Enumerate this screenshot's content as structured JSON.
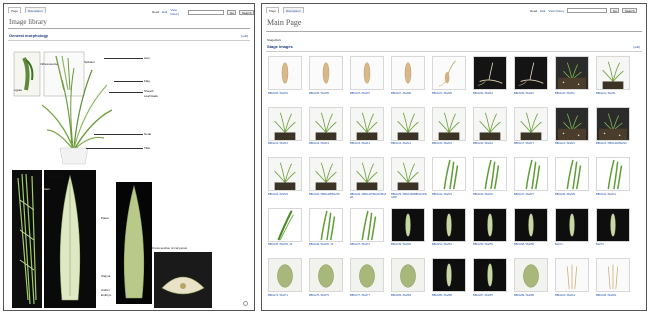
{
  "left": {
    "tabs": [
      "Page",
      "Discussion"
    ],
    "actions": [
      "Read",
      "Edit",
      "View history"
    ],
    "buttons": [
      "Go",
      "Search"
    ],
    "title": "Image library",
    "section_title": "General morphology",
    "edit_label": "[edit]",
    "morph_labels": {
      "inflorescence": "Inflorescence",
      "spikelet": "Spikelet",
      "awn": "Awn",
      "flag": "Flag",
      "sheath": "Sheath",
      "leaf_blade": "Leaf blade",
      "ligule": "Ligule",
      "node": "Node",
      "tiller": "Tiller"
    },
    "spikelet_labels": {
      "title": "Spikelet",
      "awn": "Awn",
      "palea": "Palea",
      "stigma": "Stigma",
      "anther": "Anther",
      "embryo": "Embryo",
      "cross_section": "Cross section of caryopsis"
    }
  },
  "right": {
    "tabs": [
      "Page",
      "Discussion"
    ],
    "actions": [
      "Read",
      "Edit",
      "View history"
    ],
    "buttons": [
      "Go",
      "Search"
    ],
    "title": "Main Page",
    "breadcrumb": "StageDefs",
    "section_title": "Stage images",
    "edit_label": "[edit]",
    "stages": [
      {
        "cap": "BBCH03 / BoZ01",
        "kind": "seed"
      },
      {
        "cap": "BBCH05 / BoZ05",
        "kind": "seed"
      },
      {
        "cap": "BBCH07 / BoZ07",
        "kind": "seed"
      },
      {
        "cap": "BBCH07 / BoZ08",
        "kind": "seed"
      },
      {
        "cap": "BBCH07 / BoZ09",
        "kind": "sprout"
      },
      {
        "cap": "BBCH09 / BoZ10",
        "kind": "sprout-dark"
      },
      {
        "cap": "BBCH09 / BoZ10",
        "kind": "sprout-dark"
      },
      {
        "cap": "BBCH10 / BoZ11",
        "kind": "pot-dark"
      },
      {
        "cap": "BBCH11 / BoZ11",
        "kind": "pot"
      },
      {
        "cap": "BBCH12 / BoZ12",
        "kind": "pot"
      },
      {
        "cap": "BBCH13 / BoZ13",
        "kind": "pot"
      },
      {
        "cap": "BBCH13 / BoZ13",
        "kind": "pot"
      },
      {
        "cap": "BBCH14 / BoZ14",
        "kind": "pot"
      },
      {
        "cap": "BBCH15 / BoZ15",
        "kind": "pot"
      },
      {
        "cap": "BBCH16 / BoZ16",
        "kind": "pot"
      },
      {
        "cap": "BBCH17 / BoZ17",
        "kind": "pot"
      },
      {
        "cap": "BBCH21 / BoZ21",
        "kind": "pot-dark"
      },
      {
        "cap": "BBCH21 / BBCH22/BoZ22",
        "kind": "pot-dark"
      },
      {
        "cap": "BBCH23 / BoZ23",
        "kind": "pot"
      },
      {
        "cap": "BBCH24 / BBCH25/BoZ25",
        "kind": "pot"
      },
      {
        "cap": "BBCH26 / BBCH27/BoZ27/BoZ28",
        "kind": "pot"
      },
      {
        "cap": "BBCH29 / BBCH30/BBCH31/BoZ30",
        "kind": "pot"
      },
      {
        "cap": "BBCH31 / BoZ31",
        "kind": "leaf"
      },
      {
        "cap": "BBCH32 / BoZ32",
        "kind": "leaf"
      },
      {
        "cap": "BBCH37 / BoZ37",
        "kind": "leaf"
      },
      {
        "cap": "BBCH39 / BoZ39",
        "kind": "leaf"
      },
      {
        "cap": "BBCH41 / BoZ41",
        "kind": "leaf"
      },
      {
        "cap": "BBCH45 / BoZ45, 16",
        "kind": "leaf-dark"
      },
      {
        "cap": "BBCH45 / BoZ45, 16",
        "kind": "leaf"
      },
      {
        "cap": "BBCH47 / BoZ47",
        "kind": "leaf"
      },
      {
        "cap": "BBCH49 / BoZ49",
        "kind": "spike-dark"
      },
      {
        "cap": "BBCH51 / BoZ51",
        "kind": "spike-dark"
      },
      {
        "cap": "BBCH55 / BoZ55",
        "kind": "spike-dark"
      },
      {
        "cap": "BBCH58 / BoZ58",
        "kind": "spike-dark"
      },
      {
        "cap": "BoZ71",
        "kind": "spike-dark"
      },
      {
        "cap": "BoZ73",
        "kind": "spike-dark"
      },
      {
        "cap": "BBCH71 / BoZ71",
        "kind": "grain-dark"
      },
      {
        "cap": "BBCH75 / BoZ75",
        "kind": "grain-dark"
      },
      {
        "cap": "BBCH77 / BoZ77",
        "kind": "grain-dark"
      },
      {
        "cap": "BBCH83 / BoZ83",
        "kind": "grain-dark"
      },
      {
        "cap": "BBCH85 / BoZ85",
        "kind": "spike-dark"
      },
      {
        "cap": "BBCH87 / BoZ87",
        "kind": "spike-dark"
      },
      {
        "cap": "BBCH89 / BoZ89",
        "kind": "grain-dark"
      },
      {
        "cap": "BBCH91 / BoZ91",
        "kind": "dry"
      },
      {
        "cap": "BBCH93 / BoZ93",
        "kind": "dry"
      }
    ]
  }
}
